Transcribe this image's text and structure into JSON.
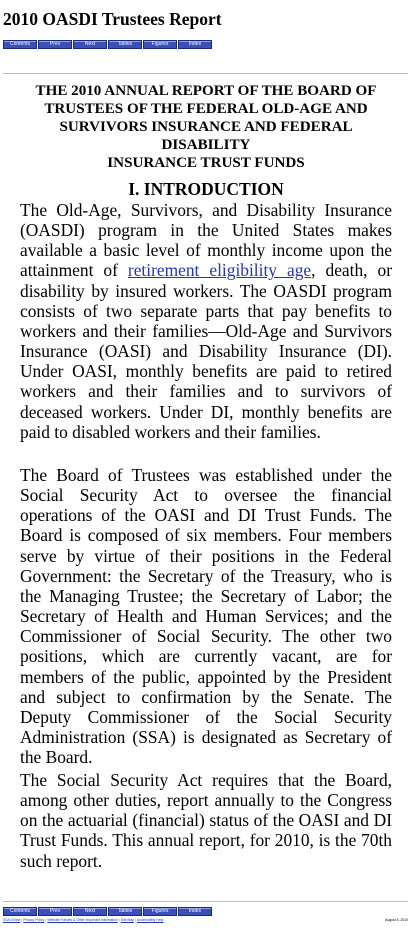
{
  "page": {
    "title": "2010 OASDI Trustees Report"
  },
  "nav": {
    "buttons": [
      "Contents",
      "Prev",
      "Next",
      "Tables",
      "Figures",
      "Index"
    ]
  },
  "report": {
    "heading_lines": [
      "THE 2010 ANNUAL REPORT OF THE BOARD OF",
      "TRUSTEES OF THE FEDERAL OLD-AGE AND",
      "SURVIVORS INSURANCE AND FEDERAL",
      "DISABILITY",
      "INSURANCE TRUST FUNDS"
    ],
    "section_title": "I. INTRODUCTION",
    "p1_before": "The Old-Age, Survivors, and Disability Insurance (OASDI) program in the United States makes available a basic level of monthly income upon the attainment of ",
    "p1_link": "retirement eligibility age",
    "p1_after": ", death, or disability by insured workers. The OASDI program consists of two separate parts that pay benefits to workers and their families—Old-Age and Survivors Insurance (OASI) and Disability Insurance (DI). Under OASI, monthly benefits are paid to retired workers and their families and to survivors of deceased workers. Under DI, monthly benefits are paid to disabled workers and their families.",
    "p2": "The Board of Trustees was established under the Social Security Act to oversee the financial operations of the OASI and DI Trust Funds. The Board is composed of six members. Four members serve by virtue of their positions in the Federal Government: the Secretary of the Treasury, who is the Managing Trustee; the Secretary of Labor; the Secretary of Health and Human Services; and the Commissioner of Social Security. The other two positions, which are currently vacant, are for members of the public, appointed by the President and subject to confirmation by the Senate. The Deputy Commissioner of the Social Security Administration (SSA) is designated as Secretary of the Board.",
    "p3": "The Social Security Act requires that the Board, among other duties, report annually to the Congress on the actuarial (financial) status of the OASI and DI Trust Funds. This annual report, for 2010, is the 70th such report."
  },
  "footer": {
    "links": [
      "SSA Online",
      "Privacy Policy",
      "Website Policies & Other Important Information",
      "Site Map",
      "Accessibility Help"
    ],
    "date": "August 5, 2010"
  }
}
